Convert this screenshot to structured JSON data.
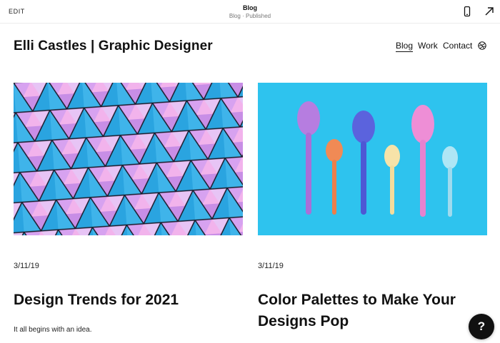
{
  "editor_bar": {
    "edit_label": "EDIT",
    "page_title": "Blog",
    "page_status": "Blog · Published",
    "icons": [
      "mobile-preview-icon",
      "open-external-icon"
    ]
  },
  "site": {
    "title": "Elli Castles | Graphic Designer",
    "nav": [
      {
        "label": "Blog",
        "active": true
      },
      {
        "label": "Work",
        "active": false
      },
      {
        "label": "Contact",
        "active": false
      }
    ],
    "social_icon": "dribbble-icon"
  },
  "posts": [
    {
      "image": "geometric-triangle-pattern",
      "date": "3/11/19",
      "title": "Design Trends for 2021",
      "excerpt": "It all begins with an idea."
    },
    {
      "image": "colorful-spoons-on-blue",
      "date": "3/11/19",
      "title": "Color Palettes to Make Your Designs Pop",
      "excerpt": ""
    }
  ],
  "help_button": {
    "label": "?"
  },
  "colors": {
    "pink": "#f2a6e6",
    "lavender": "#c9a6ee",
    "cyan": "#2fbfe6",
    "blue_bg": "#2ec3ee",
    "dark": "#111111"
  }
}
